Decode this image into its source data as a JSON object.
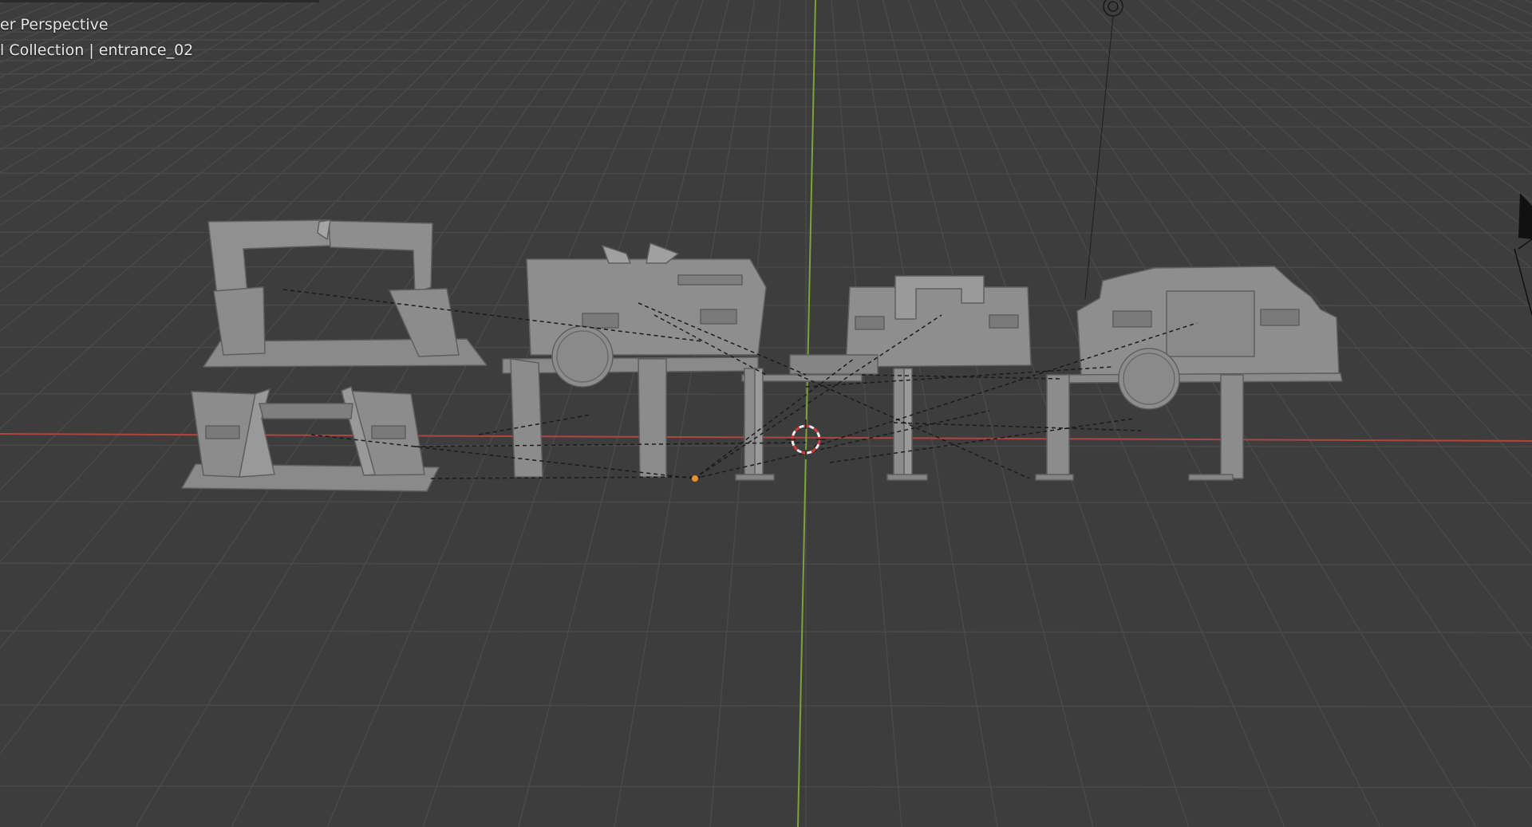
{
  "viewport": {
    "view_name": "er Perspective",
    "collection_label": "l Collection | entrance_02"
  },
  "colors": {
    "background": "#3d3d3d",
    "grid": "#4a4a4a",
    "x_axis": "#b0443f",
    "y_axis": "#7ea23a",
    "mesh": "#8a8a8a",
    "mesh_dark": "#6b6b6b",
    "selection_origin": "#e8902a",
    "cursor_red": "#d63a3a"
  },
  "icons": {
    "light": "light-emitter-icon",
    "camera": "camera-icon",
    "cursor": "3d-cursor-icon"
  }
}
